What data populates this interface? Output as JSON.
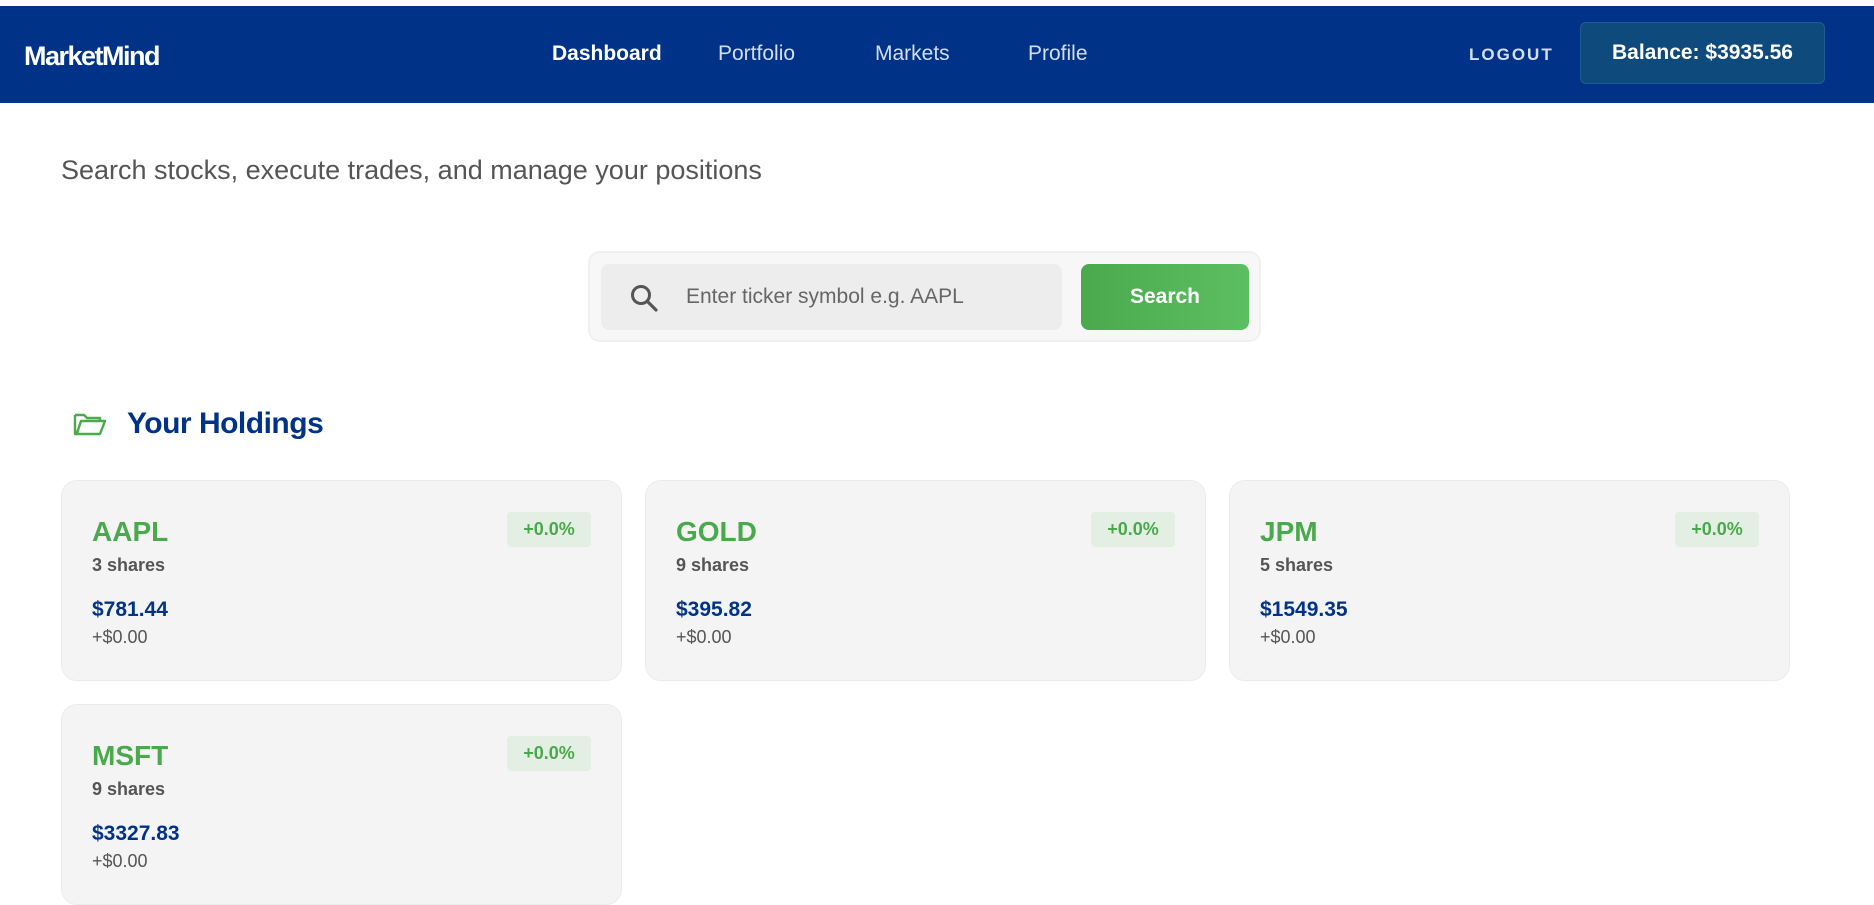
{
  "nav": {
    "brand": "MarketMind",
    "links": [
      "Dashboard",
      "Portfolio",
      "Markets",
      "Profile"
    ],
    "logout": "LOGOUT",
    "balance": "Balance: $3935.56"
  },
  "main": {
    "subtitle": "Search stocks, execute trades, and manage your positions",
    "search": {
      "placeholder": "Enter ticker symbol e.g. AAPL",
      "value": "",
      "button": "Search"
    },
    "holdings_title": "Your Holdings",
    "holdings": [
      {
        "ticker": "AAPL",
        "shares": "3 shares",
        "value": "$781.44",
        "change": "+$0.00",
        "pct": "+0.0%"
      },
      {
        "ticker": "GOLD",
        "shares": "9 shares",
        "value": "$395.82",
        "change": "+$0.00",
        "pct": "+0.0%"
      },
      {
        "ticker": "JPM",
        "shares": "5 shares",
        "value": "$1549.35",
        "change": "+$0.00",
        "pct": "+0.0%"
      },
      {
        "ticker": "MSFT",
        "shares": "9 shares",
        "value": "$3327.83",
        "change": "+$0.00",
        "pct": "+0.0%"
      }
    ]
  },
  "colors": {
    "navbar": "#003387",
    "accent_green": "#4aa94d",
    "balance_bg": "#0f4a7d",
    "card_bg": "#f4f4f4"
  },
  "icons": {
    "search": "search-icon",
    "holdings": "folder-open-icon"
  }
}
